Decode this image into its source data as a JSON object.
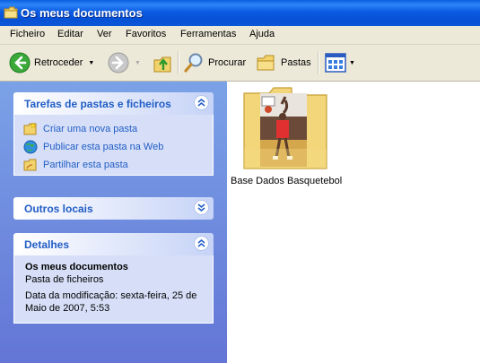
{
  "window": {
    "title": "Os meus documentos"
  },
  "menu": [
    "Ficheiro",
    "Editar",
    "Ver",
    "Favoritos",
    "Ferramentas",
    "Ajuda"
  ],
  "toolbar": {
    "back_label": "Retroceder",
    "search_label": "Procurar",
    "folders_label": "Pastas"
  },
  "tasks_panel": {
    "title": "Tarefas de pastas e ficheiros",
    "items": [
      "Criar uma nova pasta",
      "Publicar esta pasta na Web",
      "Partilhar esta pasta"
    ]
  },
  "other_places": {
    "title": "Outros locais"
  },
  "details": {
    "title": "Detalhes",
    "name": "Os meus documentos",
    "type": "Pasta de ficheiros",
    "modified": "Data da modificação: sexta-feira, 25 de Maio de 2007, 5:53"
  },
  "files": [
    {
      "name": "Base Dados Basquetebol",
      "icon": "folder-with-photo-icon"
    }
  ],
  "colors": {
    "titlebar": "#0a5fe0",
    "taskpane": "#7ba2e7",
    "link": "#215dc6",
    "panel_body": "#d6dff7"
  }
}
